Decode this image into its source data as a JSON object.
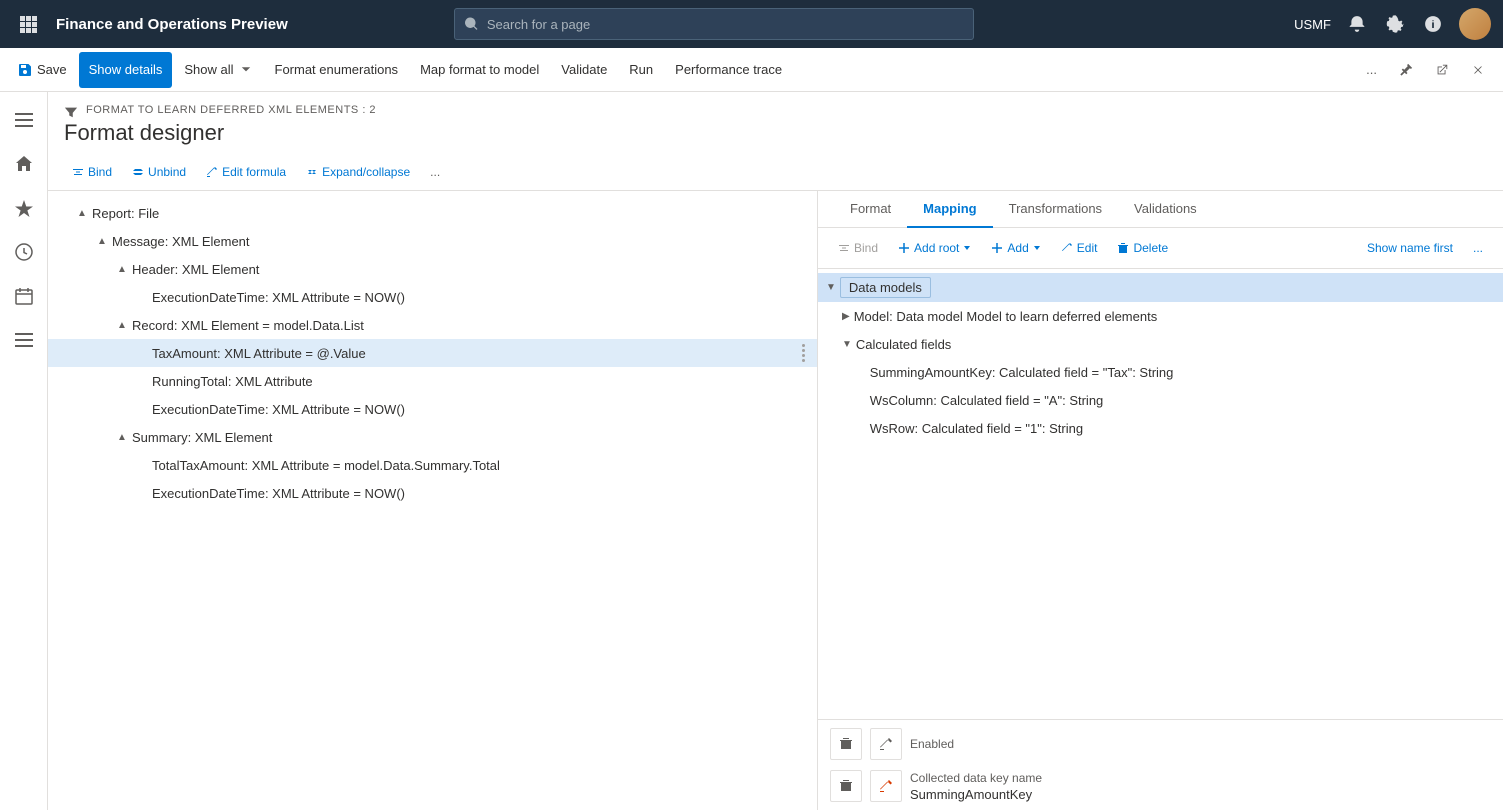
{
  "topbar": {
    "app_title": "Finance and Operations Preview",
    "search_placeholder": "Search for a page",
    "user": "USMF"
  },
  "command_bar": {
    "save_label": "Save",
    "show_details_label": "Show details",
    "show_all_label": "Show all",
    "format_enumerations_label": "Format enumerations",
    "map_format_to_model_label": "Map format to model",
    "validate_label": "Validate",
    "run_label": "Run",
    "performance_trace_label": "Performance trace"
  },
  "page": {
    "breadcrumb": "FORMAT TO LEARN DEFERRED XML ELEMENTS : 2",
    "title": "Format designer"
  },
  "toolbar": {
    "bind_label": "Bind",
    "unbind_label": "Unbind",
    "edit_formula_label": "Edit formula",
    "expand_collapse_label": "Expand/collapse",
    "more_label": "..."
  },
  "format_tree": {
    "items": [
      {
        "indent": 1,
        "label": "Report: File",
        "toggle": "▲",
        "level": 0
      },
      {
        "indent": 2,
        "label": "Message: XML Element",
        "toggle": "▲",
        "level": 1
      },
      {
        "indent": 3,
        "label": "Header: XML Element",
        "toggle": "▲",
        "level": 2
      },
      {
        "indent": 4,
        "label": "ExecutionDateTime: XML Attribute = NOW()",
        "toggle": "",
        "level": 3
      },
      {
        "indent": 3,
        "label": "Record: XML Element = model.Data.List",
        "toggle": "▲",
        "level": 2
      },
      {
        "indent": 4,
        "label": "TaxAmount: XML Attribute = @.Value",
        "toggle": "",
        "level": 3,
        "selected": true
      },
      {
        "indent": 4,
        "label": "RunningTotal: XML Attribute",
        "toggle": "",
        "level": 3
      },
      {
        "indent": 4,
        "label": "ExecutionDateTime: XML Attribute = NOW()",
        "toggle": "",
        "level": 3
      },
      {
        "indent": 3,
        "label": "Summary: XML Element",
        "toggle": "▲",
        "level": 2
      },
      {
        "indent": 4,
        "label": "TotalTaxAmount: XML Attribute = model.Data.Summary.Total",
        "toggle": "",
        "level": 3
      },
      {
        "indent": 4,
        "label": "ExecutionDateTime: XML Attribute = NOW()",
        "toggle": "",
        "level": 3
      }
    ]
  },
  "mapping_tabs": {
    "items": [
      {
        "label": "Format",
        "active": false
      },
      {
        "label": "Mapping",
        "active": true
      },
      {
        "label": "Transformations",
        "active": false
      },
      {
        "label": "Validations",
        "active": false
      }
    ]
  },
  "mapping_toolbar": {
    "bind_label": "Bind",
    "add_root_label": "Add root",
    "add_label": "Add",
    "edit_label": "Edit",
    "delete_label": "Delete",
    "show_name_first_label": "Show name first"
  },
  "mapping_tree": {
    "items": [
      {
        "indent": 0,
        "label": "Data models",
        "toggle": "▼",
        "selected": true,
        "bold": true
      },
      {
        "indent": 1,
        "label": "Model: Data model Model to learn deferred elements",
        "toggle": "▶"
      },
      {
        "indent": 1,
        "label": "Calculated fields",
        "toggle": "▼"
      },
      {
        "indent": 2,
        "label": "SummingAmountKey: Calculated field = \"Tax\": String",
        "toggle": ""
      },
      {
        "indent": 2,
        "label": "WsColumn: Calculated field = \"A\": String",
        "toggle": ""
      },
      {
        "indent": 2,
        "label": "WsRow: Calculated field = \"1\": String",
        "toggle": ""
      }
    ]
  },
  "bottom_panel": {
    "enabled_label": "Enabled",
    "collected_data_key_name_label": "Collected data key name",
    "collected_data_key_value": "SummingAmountKey"
  }
}
